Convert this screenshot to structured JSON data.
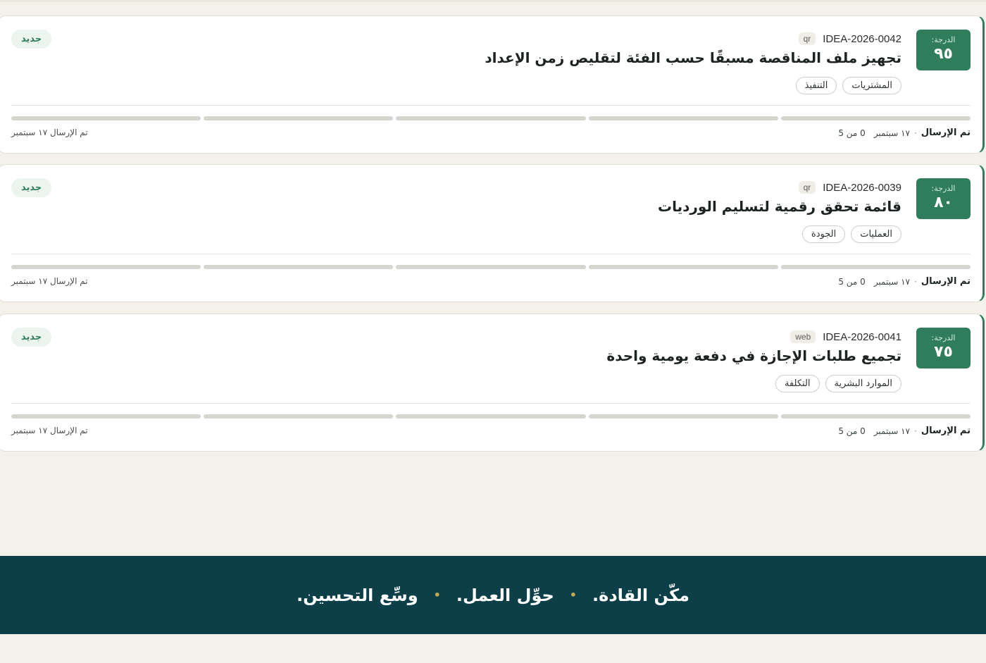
{
  "cards": [
    {
      "score_label": "الدرجة:",
      "score_value": "٩٥",
      "idea_id": "IDEA-2026-0042",
      "source": "qr",
      "title": "تجهيز ملف المناقصة مسبقًا حسب الفئة لتقليص زمن الإعداد",
      "tags": [
        "المشتريات",
        "التنفيذ"
      ],
      "status": "جديد",
      "progress": {
        "filled": 0,
        "total": 5
      },
      "footer": {
        "sent_label": "تم الإرسال",
        "date": "١٧ سبتمبر",
        "count": "0 من 5"
      },
      "footer_left": "تم الإرسال ١٧ سبتمبر"
    },
    {
      "score_label": "الدرجة:",
      "score_value": "٨٠",
      "idea_id": "IDEA-2026-0039",
      "source": "qr",
      "title": "قائمة تحقق رقمية لتسليم الورديات",
      "tags": [
        "العمليات",
        "الجودة"
      ],
      "status": "جديد",
      "progress": {
        "filled": 0,
        "total": 5
      },
      "footer": {
        "sent_label": "تم الإرسال",
        "date": "١٧ سبتمبر",
        "count": "0 من 5"
      },
      "footer_left": "تم الإرسال ١٧ سبتمبر"
    },
    {
      "score_label": "الدرجة:",
      "score_value": "٧٥",
      "idea_id": "IDEA-2026-0041",
      "source": "web",
      "title": "تجميع طلبات الإجازة في دفعة يومية واحدة",
      "tags": [
        "الموارد البشرية",
        "التكلفة"
      ],
      "status": "جديد",
      "progress": {
        "filled": 0,
        "total": 5
      },
      "footer": {
        "sent_label": "تم الإرسال",
        "date": "١٧ سبتمبر",
        "count": "0 من 5"
      },
      "footer_left": "تم الإرسال ١٧ سبتمبر"
    }
  ],
  "banner": {
    "items": [
      "مكّن القادة.",
      "حوِّل العمل.",
      "وسِّع التحسين."
    ]
  },
  "colors": {
    "accent": "#2f7d5b",
    "banner_bg": "#0d3f48",
    "banner_dot": "#c9a84a",
    "page_bg": "#f4f1ea"
  }
}
